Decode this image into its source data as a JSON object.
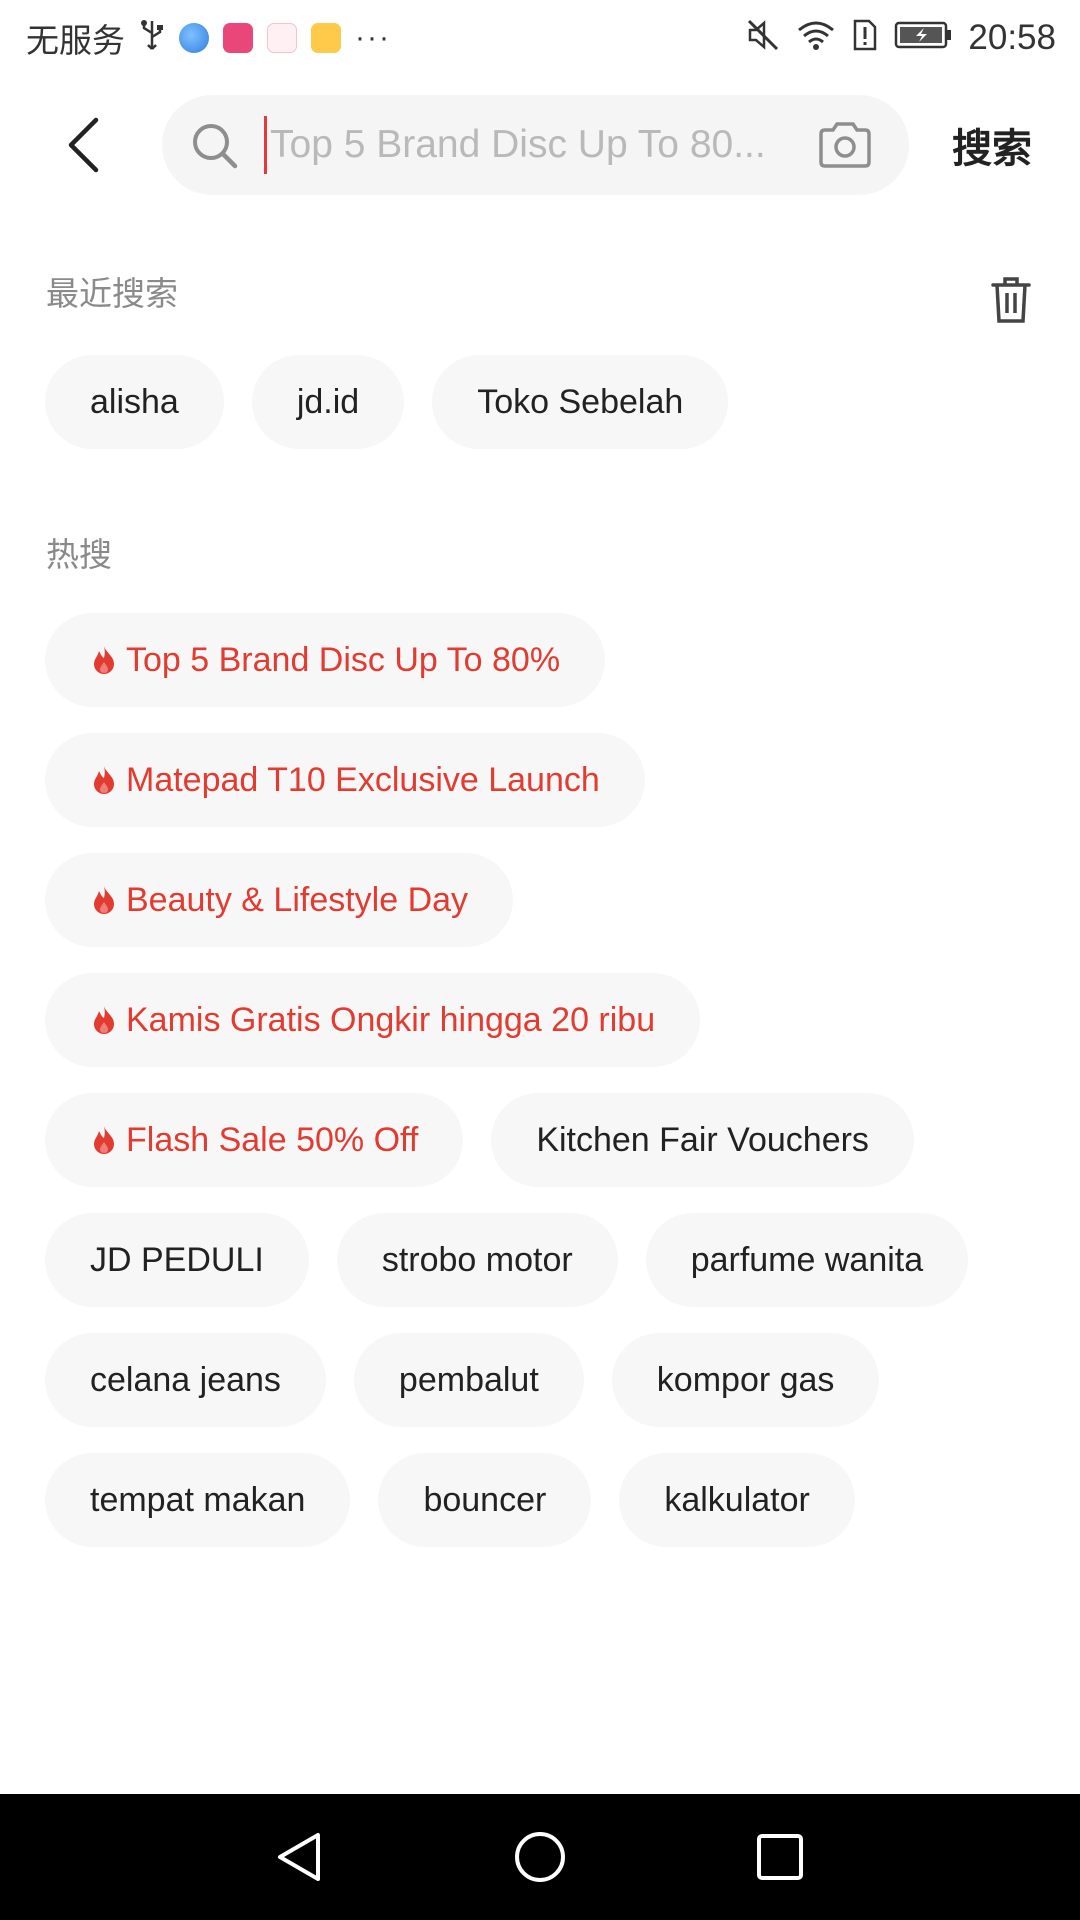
{
  "status_bar": {
    "carrier": "无服务",
    "more": "···",
    "time": "20:58",
    "icons": [
      "usb-icon",
      "browser-app-icon",
      "store-app-icon",
      "fm-app-icon",
      "mail-app-icon",
      "mute-icon",
      "wifi-icon",
      "alert-sim-icon",
      "battery-icon"
    ]
  },
  "search": {
    "placeholder": "Top 5 Brand Disc Up To 80...",
    "value": "",
    "submit_label": "搜索"
  },
  "recent": {
    "title": "最近搜索",
    "items": [
      "alisha",
      "jd.id",
      "Toko Sebelah"
    ]
  },
  "hot": {
    "title": "热搜",
    "accent_color": "#e23b30",
    "rows": [
      [
        {
          "label": "Top 5 Brand Disc Up To 80%",
          "hot": true
        }
      ],
      [
        {
          "label": "Matepad T10 Exclusive Launch",
          "hot": true
        }
      ],
      [
        {
          "label": "Beauty & Lifestyle Day",
          "hot": true
        }
      ],
      [
        {
          "label": "Kamis Gratis Ongkir hingga 20 ribu",
          "hot": true
        }
      ],
      [
        {
          "label": "Flash Sale 50% Off",
          "hot": true
        },
        {
          "label": "Kitchen Fair Vouchers",
          "hot": false
        }
      ],
      [
        {
          "label": "JD PEDULI",
          "hot": false
        },
        {
          "label": "strobo motor",
          "hot": false
        },
        {
          "label": "parfume wanita",
          "hot": false
        }
      ],
      [
        {
          "label": "celana jeans",
          "hot": false
        },
        {
          "label": "pembalut",
          "hot": false
        },
        {
          "label": "kompor gas",
          "hot": false
        }
      ],
      [
        {
          "label": "tempat makan",
          "hot": false
        },
        {
          "label": "bouncer",
          "hot": false
        },
        {
          "label": "kalkulator",
          "hot": false
        }
      ]
    ]
  },
  "nav_bar": {
    "buttons": [
      "back-triangle-icon",
      "home-circle-icon",
      "recents-square-icon"
    ]
  }
}
